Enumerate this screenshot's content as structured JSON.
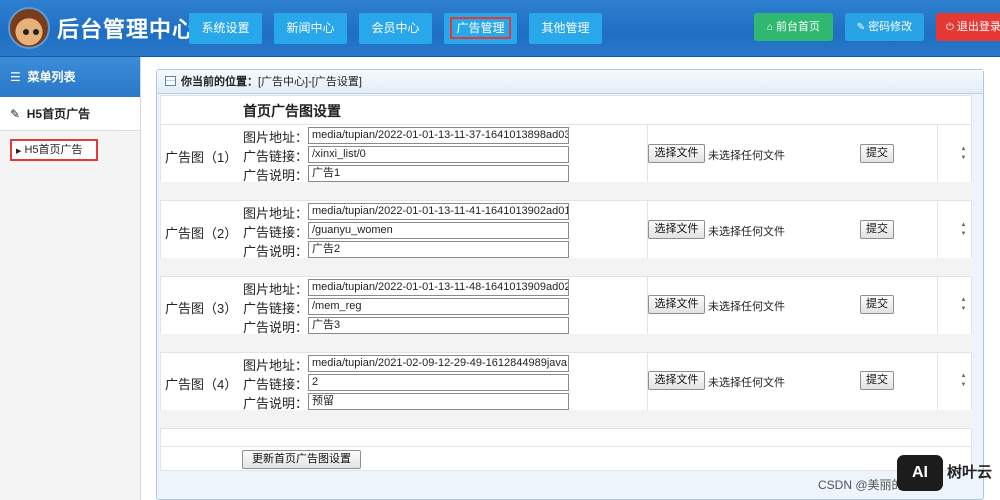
{
  "header": {
    "title": "后台管理中心",
    "nav": [
      {
        "label": "系统设置"
      },
      {
        "label": "新闻中心"
      },
      {
        "label": "会员中心"
      },
      {
        "label": "广告管理"
      },
      {
        "label": "其他管理"
      }
    ],
    "actions": {
      "home": "前台首页",
      "password": "密码修改",
      "logout": "退出登录"
    },
    "colors": {
      "home": "#2eb872",
      "password": "#27a3e6",
      "logout": "#e53935"
    }
  },
  "sidebar": {
    "title": "菜单列表",
    "group": "H5首页广告",
    "item": "H5首页广告"
  },
  "breadcrumb": {
    "prefix": "你当前的位置：",
    "path": "[广告中心]-[广告设置]"
  },
  "form": {
    "title": "首页广告图设置",
    "field_labels": {
      "image": "图片地址：",
      "link": "广告链接：",
      "desc": "广告说明："
    },
    "choose_file": "选择文件",
    "no_file": "未选择任何文件",
    "submit": "提交",
    "ads": [
      {
        "label": "广告图（1）",
        "image": "media/tupian/2022-01-01-13-11-37-1641013898ad03",
        "link": "/xinxi_list/0",
        "desc": "广告1"
      },
      {
        "label": "广告图（2）",
        "image": "media/tupian/2022-01-01-13-11-41-1641013902ad01",
        "link": "/guanyu_women",
        "desc": "广告2"
      },
      {
        "label": "广告图（3）",
        "image": "media/tupian/2022-01-01-13-11-48-1641013909ad02",
        "link": "/mem_reg",
        "desc": "广告3"
      },
      {
        "label": "广告图（4）",
        "image": "media/tupian/2021-02-09-12-29-49-1612844989java",
        "link": "2",
        "desc": "预留"
      }
    ],
    "update_button": "更新首页广告图设置"
  },
  "watermark": {
    "text": "CSDN @美丽的老师",
    "logo": "AI",
    "brand": "树叶云"
  }
}
